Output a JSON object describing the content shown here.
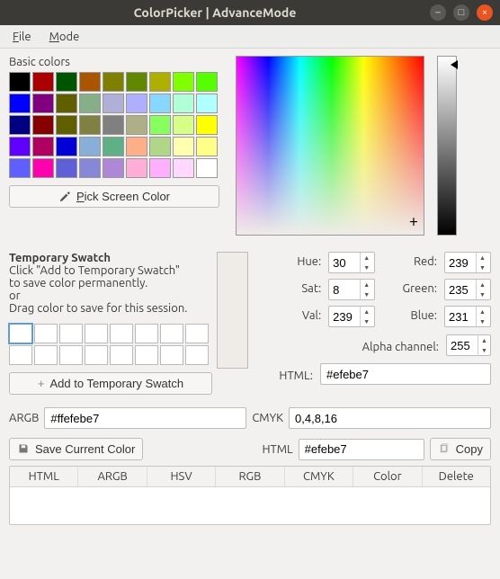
{
  "window": {
    "title": "ColorPicker | AdvanceMode"
  },
  "menu": {
    "file": "File",
    "mode": "Mode"
  },
  "basic": {
    "label": "Basic colors",
    "colors": [
      "#000000",
      "#aa0000",
      "#005500",
      "#aa5500",
      "#808000",
      "#5f8700",
      "#afaf00",
      "#80ff00",
      "#55ff00",
      "#0000ff",
      "#800080",
      "#5f5f00",
      "#87af87",
      "#afafd7",
      "#afafff",
      "#87d7ff",
      "#afffd7",
      "#afffff",
      "#000080",
      "#870000",
      "#5f5f00",
      "#808040",
      "#808080",
      "#afaf87",
      "#87ff5f",
      "#d7ff87",
      "#ffff00",
      "#5f00ff",
      "#af005f",
      "#0000d7",
      "#87afd7",
      "#5faf87",
      "#ffaf87",
      "#afd787",
      "#ffffaf",
      "#ffff87",
      "#5f5fff",
      "#ff00af",
      "#5f5fd7",
      "#8787d7",
      "#af87d7",
      "#ffafd7",
      "#ffafff",
      "#ffd7ff",
      "#ffffff"
    ],
    "pick_button": "Pick Screen Color"
  },
  "temp": {
    "title": "Temporary Swatch",
    "line1": "Click \"Add to Temporary Swatch\"",
    "line2": "to save color permanently.",
    "line3": "or",
    "line4": "Drag color to save for this session.",
    "add_button": "Add to Temporary Swatch"
  },
  "channels": {
    "hue_label": "Hue:",
    "hue": "30",
    "sat_label": "Sat:",
    "sat": "8",
    "val_label": "Val:",
    "val": "239",
    "red_label": "Red:",
    "red": "239",
    "green_label": "Green:",
    "green": "235",
    "blue_label": "Blue:",
    "blue": "231",
    "alpha_label": "Alpha channel:",
    "alpha": "255",
    "html_label": "HTML:",
    "html": "#efebe7"
  },
  "lower": {
    "argb_label": "ARGB",
    "argb": "#ffefebe7",
    "cmyk_label": "CMYK",
    "cmyk": "0,4,8,16",
    "save_button": "Save Current Color",
    "html2_label": "HTML",
    "html2": "#efebe7",
    "copy_button": "Copy"
  },
  "table": {
    "cols": [
      "HTML",
      "ARGB",
      "HSV",
      "RGB",
      "CMYK",
      "Color",
      "Delete"
    ]
  },
  "current_color": "#efebe7"
}
